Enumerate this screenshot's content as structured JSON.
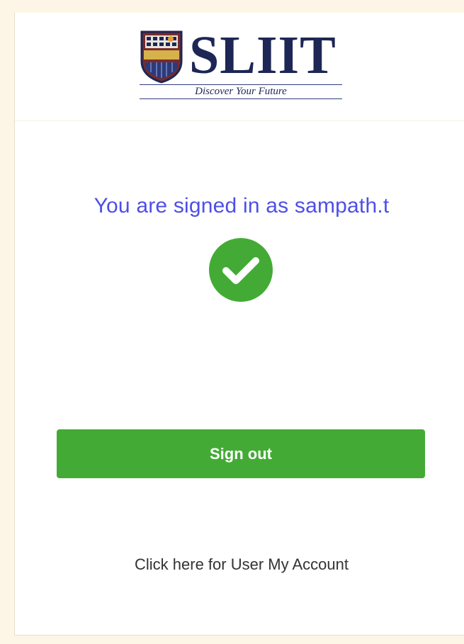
{
  "header": {
    "logo_text": "SLIIT",
    "logo_crest_text": "SLIIT",
    "tagline": "Discover Your Future"
  },
  "main": {
    "signed_in_message": "You are signed in as sampath.t",
    "status_icon": "check-circle-icon",
    "sign_out_label": "Sign out",
    "account_link_label": "Click here for User My Account"
  },
  "colors": {
    "page_background": "#fdf6e6",
    "message_text": "#4e4fe6",
    "success_green": "#43ab35",
    "logo_navy": "#1d2655"
  }
}
